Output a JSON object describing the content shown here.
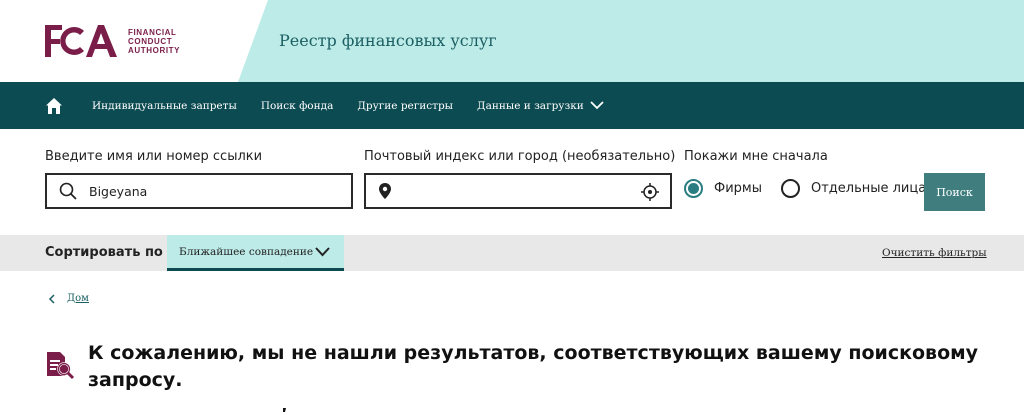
{
  "header": {
    "logo_letters": "FCA",
    "logo_lines": [
      "FINANCIAL",
      "CONDUCT",
      "AUTHORITY"
    ],
    "registry_title": "Реестр финансовых услуг"
  },
  "nav": {
    "home_icon": "home-icon",
    "items": [
      "Индивидуальные запреты",
      "Поиск фонда",
      "Другие регистры",
      "Данные и загрузки"
    ]
  },
  "search": {
    "name_label": "Введите имя или номер ссылки",
    "name_value": "Bigeyana",
    "location_label": "Почтовый индекс или город (необязательно)",
    "location_value": "",
    "show_first_label": "Покажи мне сначала",
    "options": [
      "Фирмы",
      "Отдельные лица"
    ],
    "selected_option": "Фирмы",
    "search_button": "Поиск"
  },
  "sort": {
    "label": "Сортировать по",
    "selected": "Ближайшее совпадение",
    "clear_filters": "Очистить фильтры"
  },
  "breadcrumb": {
    "home": "Дом"
  },
  "results": {
    "no_results_message": "К сожалению, мы не нашли результатов, соответствующих вашему поисковому запросу."
  },
  "colors": {
    "brand_maroon": "#7a1e49",
    "nav_teal": "#0d4b52",
    "header_mint": "#bdebe8",
    "button_teal": "#3f7d7f"
  }
}
